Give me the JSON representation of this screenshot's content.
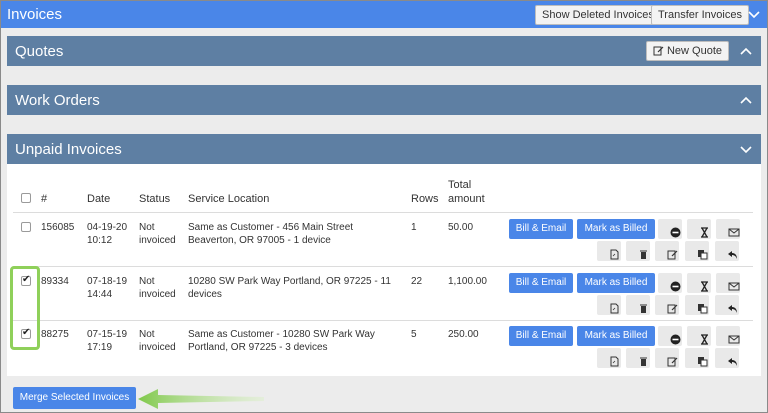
{
  "topbar": {
    "title": "Invoices",
    "show_deleted_label": "Show Deleted Invoices",
    "transfer_label": "Transfer Invoices"
  },
  "panels": {
    "quotes_title": "Quotes",
    "new_quote_label": "New Quote",
    "work_orders_title": "Work Orders",
    "unpaid_title": "Unpaid Invoices"
  },
  "table": {
    "headers": {
      "num": "#",
      "date": "Date",
      "status": "Status",
      "location": "Service Location",
      "rows": "Rows",
      "total_line1": "Total",
      "total_line2": "amount"
    },
    "rows": [
      {
        "checked": false,
        "num": "156085",
        "date_line1": "04-19-20",
        "date_line2": "10:12",
        "status_line1": "Not",
        "status_line2": "invoiced",
        "location_line1": "Same as Customer - 456 Main Street",
        "location_line2": "Beaverton, OR 97005 - 1 device",
        "rows": "1",
        "total": "50.00"
      },
      {
        "checked": true,
        "num": "89334",
        "date_line1": "07-18-19",
        "date_line2": "14:44",
        "status_line1": "Not",
        "status_line2": "invoiced",
        "location_line1": "10280 SW Park Way Portland, OR 97225 - 11",
        "location_line2": "devices",
        "rows": "22",
        "total": "1,100.00"
      },
      {
        "checked": true,
        "num": "88275",
        "date_line1": "07-15-19",
        "date_line2": "17:19",
        "status_line1": "Not",
        "status_line2": "invoiced",
        "location_line1": "Same as Customer - 10280 SW Park Way",
        "location_line2": "Portland, OR 97225 - 3 devices",
        "rows": "5",
        "total": "250.00"
      }
    ],
    "actions": {
      "bill_email_label": "Bill & Email",
      "mark_billed_label": "Mark as Billed"
    }
  },
  "merge_label": "Merge Selected Invoices",
  "colors": {
    "primary": "#4a86e8",
    "panel_header": "#5e7fa3",
    "highlight": "#8fd05a"
  },
  "icons": [
    "chevron-down-icon",
    "chevron-up-icon",
    "edit-icon",
    "minus-circle-icon",
    "hourglass-icon",
    "envelope-icon",
    "pdf-icon",
    "trash-icon",
    "pencil-icon",
    "copy-icon",
    "reply-icon",
    "arrow-icon"
  ]
}
